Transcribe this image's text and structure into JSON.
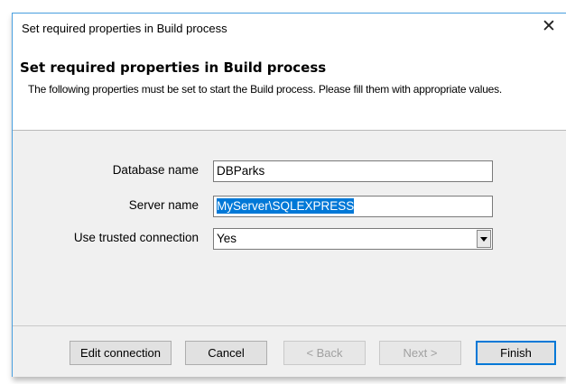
{
  "window": {
    "title": "Set required properties in Build process",
    "close_glyph": "✕"
  },
  "header": {
    "title": "Set required properties in Build process",
    "description": "The following properties must be set to start the Build process. Please fill them with appropriate values."
  },
  "form": {
    "database_name": {
      "label": "Database name",
      "value": "DBParks"
    },
    "server_name": {
      "label": "Server name",
      "value": "MyServer\\SQLEXPRESS",
      "selected": true
    },
    "trusted_connection": {
      "label": "Use trusted connection",
      "value": "Yes"
    }
  },
  "buttons": {
    "edit_connection": "Edit connection",
    "cancel": "Cancel",
    "back": "< Back",
    "next": "Next >",
    "finish": "Finish"
  },
  "colors": {
    "accent": "#0078d7",
    "window_border": "#4aa0e0",
    "panel_bg": "#f0f0f0"
  }
}
